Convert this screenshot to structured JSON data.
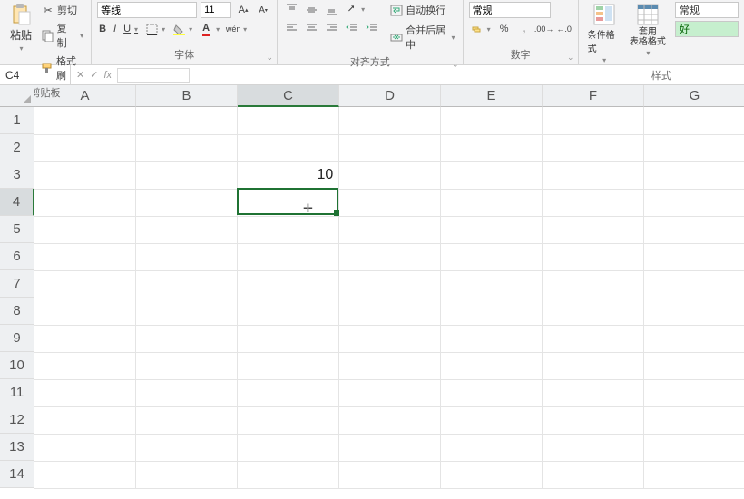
{
  "ribbon": {
    "clipboard": {
      "paste_label": "粘贴",
      "paste_dd": "▾",
      "cut_label": "剪切",
      "copy_label": "复制",
      "copy_dd": "▾",
      "format_painter_label": "格式刷",
      "group_label": "剪贴板"
    },
    "font": {
      "name_value": "等线",
      "size_value": "11",
      "bold": "B",
      "italic": "I",
      "underline": "U",
      "group_label": "字体"
    },
    "alignment": {
      "wrap_label": "自动换行",
      "merge_label": "合并后居中",
      "merge_dd": "▾",
      "group_label": "对齐方式"
    },
    "number": {
      "format_value": "常规",
      "group_label": "数字"
    },
    "styles": {
      "cond_format_label": "条件格式",
      "table_format_label": "套用\n表格格式",
      "style_normal": "常规",
      "style_good": "好",
      "group_label": "样式"
    }
  },
  "formula_bar": {
    "name_box_value": "C4",
    "cancel": "✕",
    "confirm": "✓",
    "fx": "fx"
  },
  "grid": {
    "columns": [
      "A",
      "B",
      "C",
      "D",
      "E",
      "F",
      "G"
    ],
    "rows": [
      "1",
      "2",
      "3",
      "4",
      "5",
      "6",
      "7",
      "8",
      "9",
      "10",
      "11",
      "12",
      "13",
      "14"
    ],
    "active_col_index": 2,
    "active_row_index": 3,
    "cells": {
      "C3": "10"
    },
    "cursor_glyph": "✛"
  }
}
